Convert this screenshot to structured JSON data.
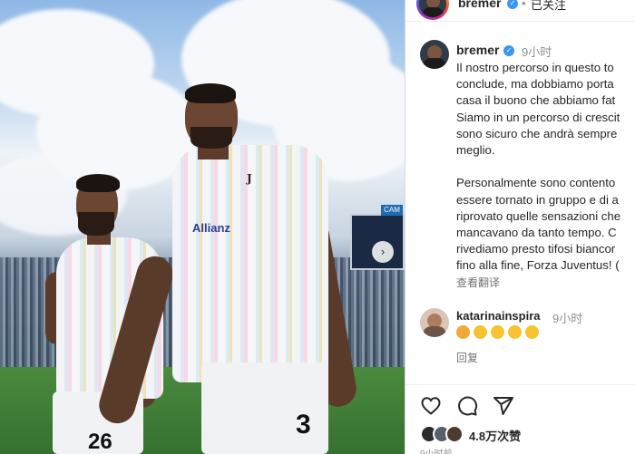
{
  "header": {
    "username": "bremer",
    "follow_status": "已关注",
    "separator": "•"
  },
  "post": {
    "author": "bremer",
    "time": "9小时",
    "caption_lines": [
      "Il nostro percorso in questo to",
      "conclude, ma dobbiamo porta",
      "casa il buono che abbiamo fat",
      "Siamo in un percorso di crescit",
      "sono sicuro che andrà sempre",
      "meglio.",
      "",
      "Personalmente sono contento",
      "essere tornato in gruppo e di a",
      "riprovato quelle sensazioni che",
      "mancavano da tanto tempo. C",
      "rivediamo presto tifosi biancor",
      "fino alla fine, Forza Juventus! ("
    ],
    "translate_label": "查看翻译"
  },
  "comment": {
    "author": "katarinainspira",
    "time": "9小时",
    "emoji_icons": [
      "star-struck-face-icon",
      "clapping-hands-icon",
      "clapping-hands-icon",
      "clapping-hands-icon",
      "clapping-hands-icon"
    ],
    "reply_label": "回复"
  },
  "actions": {
    "like_icon": "heart-icon",
    "comment_icon": "comment-bubble-icon",
    "share_icon": "paper-plane-icon"
  },
  "likes": {
    "count_label": "4.8万次赞"
  },
  "date": "9小时前",
  "photo": {
    "sponsor": "Allianz",
    "jersey_number_right": "3",
    "jersey_number_left": "26",
    "board_label": "CAM",
    "next_icon": "chevron-right-icon"
  },
  "colors": {
    "verified_blue": "#3897f0",
    "text_primary": "#262626",
    "text_muted": "#8e8e8e"
  }
}
